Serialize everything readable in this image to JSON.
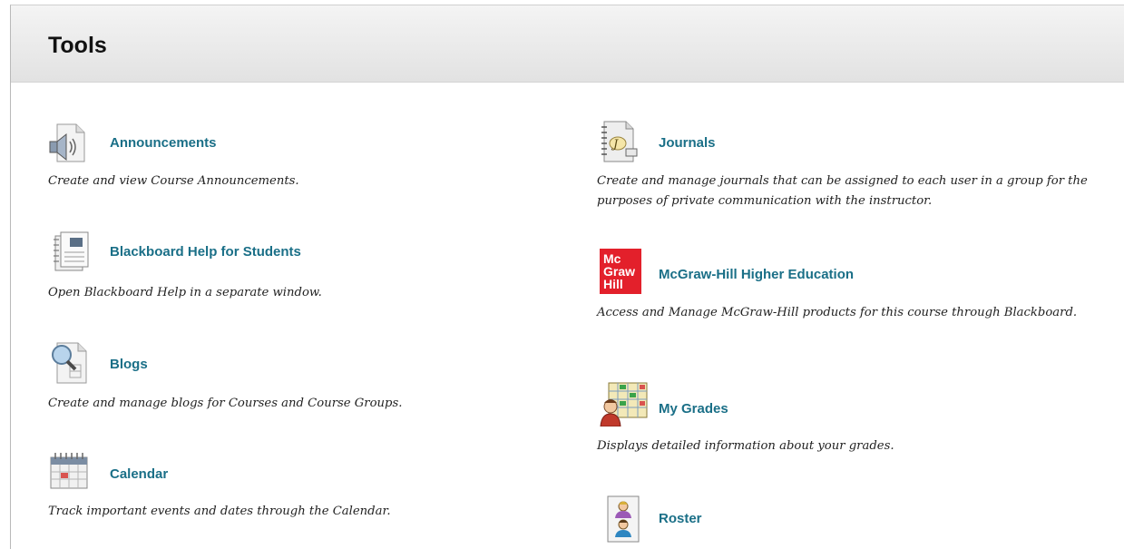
{
  "page_title": "Tools",
  "tools_left": [
    {
      "icon": "announcement-speaker-icon",
      "title": "Announcements",
      "description": "Create and view Course Announcements."
    },
    {
      "icon": "help-document-icon",
      "title": "Blackboard Help for Students",
      "description": "Open Blackboard Help in a separate window."
    },
    {
      "icon": "blog-magnifier-icon",
      "title": "Blogs",
      "description": "Create and manage blogs for Courses and Course Groups."
    },
    {
      "icon": "calendar-icon",
      "title": "Calendar",
      "description": "Track important events and dates through the Calendar."
    }
  ],
  "tools_right": [
    {
      "icon": "journal-notebook-icon",
      "title": "Journals",
      "description": "Create and manage journals that can be assigned to each user in a group for the purposes of private communication with the instructor."
    },
    {
      "icon": "mcgraw-hill-logo-icon",
      "title": "McGraw-Hill Higher Education",
      "description": "Access and Manage McGraw-Hill products for this course through Blackboard.",
      "logo_text": [
        "Mc",
        "Graw",
        "Hill"
      ]
    },
    {
      "icon": "grades-chart-icon",
      "title": "My Grades",
      "description": "Displays detailed information about your grades."
    },
    {
      "icon": "roster-people-icon",
      "title": "Roster",
      "description": ""
    }
  ],
  "colors": {
    "link": "#1a6f87",
    "mcgraw_red": "#e3202b"
  }
}
